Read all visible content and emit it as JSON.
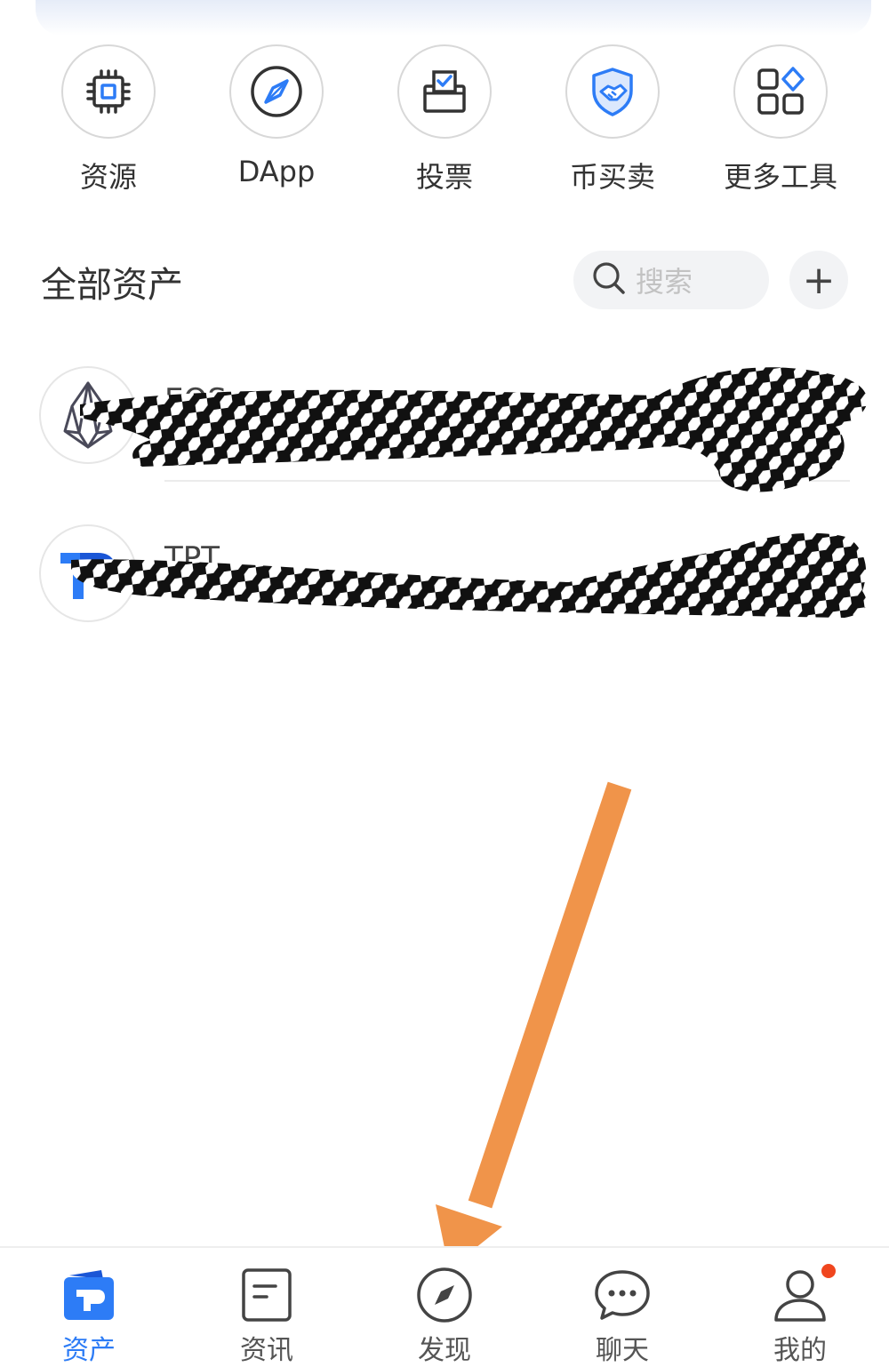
{
  "quick_actions": [
    {
      "label": "资源",
      "icon": "cpu-chip-icon"
    },
    {
      "label": "DApp",
      "icon": "compass-icon"
    },
    {
      "label": "投票",
      "icon": "ballot-box-icon"
    },
    {
      "label": "币买卖",
      "icon": "handshake-shield-icon"
    },
    {
      "label": "更多工具",
      "icon": "apps-grid-icon"
    }
  ],
  "assets": {
    "title": "全部资产",
    "search_placeholder": "搜索",
    "add_label": "+",
    "rows": [
      {
        "name": "EOS",
        "icon": "eos-logo-icon"
      },
      {
        "name": "TPT",
        "icon": "tpt-logo-icon"
      }
    ]
  },
  "bottom_nav": [
    {
      "label": "资产",
      "icon": "wallet-icon",
      "active": true
    },
    {
      "label": "资讯",
      "icon": "news-icon"
    },
    {
      "label": "发现",
      "icon": "compass-icon"
    },
    {
      "label": "聊天",
      "icon": "chat-bubble-icon"
    },
    {
      "label": "我的",
      "icon": "user-icon",
      "badge": true
    }
  ],
  "colors": {
    "accent": "#2d7cf6",
    "arrow": "#f0944a",
    "badge": "#f0461e"
  }
}
